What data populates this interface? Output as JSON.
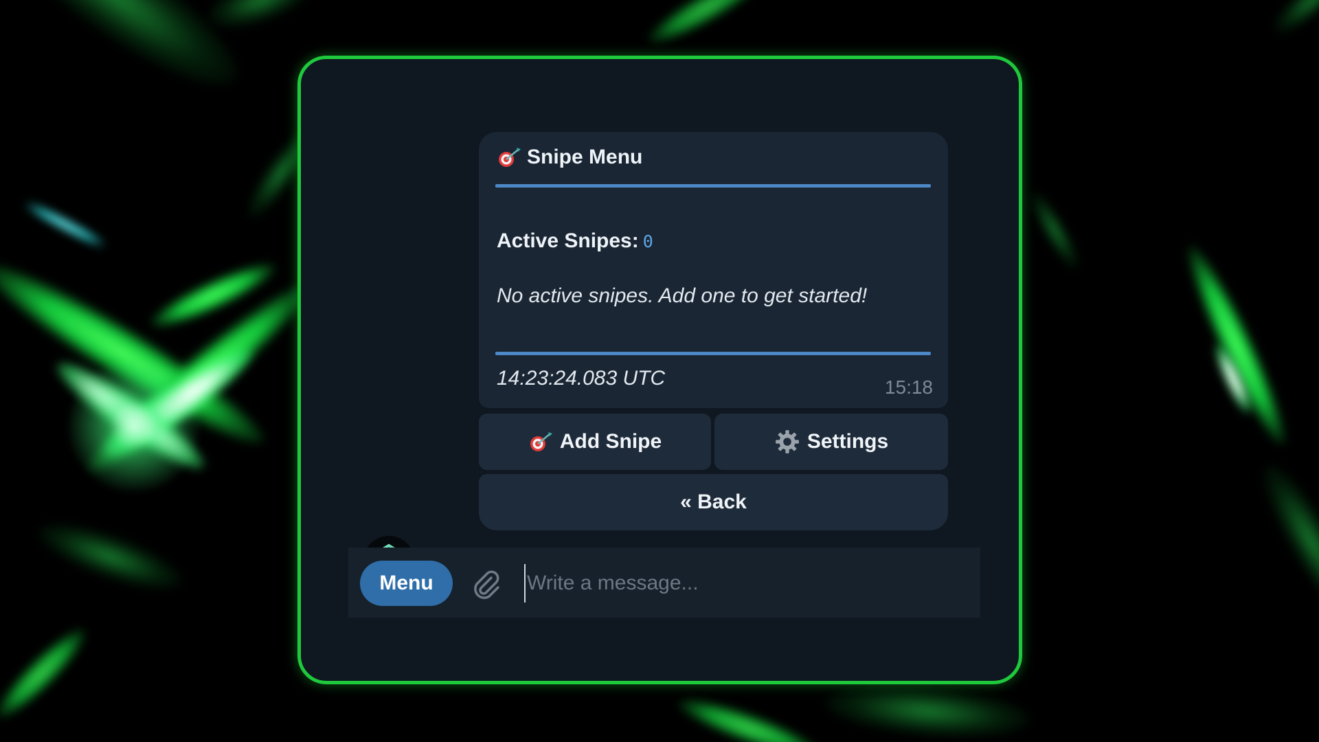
{
  "message": {
    "title": "Snipe Menu",
    "title_icon": "target-dart-icon",
    "active_label": "Active Snipes:",
    "active_count": "0",
    "empty_note": "No active snipes. Add one to get started!",
    "utc_time": "14:23:24.083 UTC",
    "sent_time": "15:18"
  },
  "keyboard": {
    "add_snipe": "Add Snipe",
    "settings": "Settings",
    "back": "« Back"
  },
  "composer": {
    "menu_label": "Menu",
    "placeholder": "Write a message..."
  },
  "colors": {
    "frame_border": "#1fc93c",
    "divider": "#4c88c6",
    "menu_button": "#2f6ea8",
    "count_accent": "#5fa6e6"
  }
}
